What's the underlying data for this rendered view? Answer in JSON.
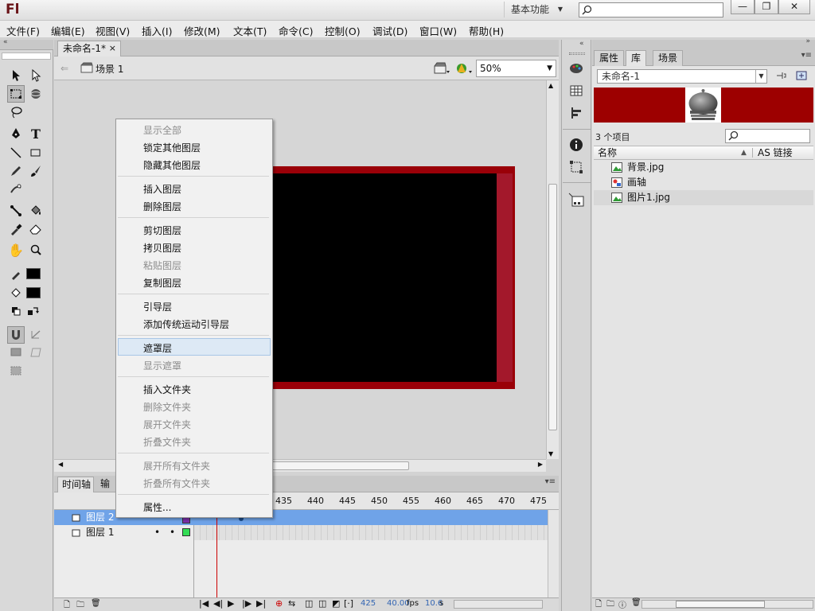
{
  "app": {
    "logo": "Fl",
    "workspace": "基本功能",
    "search_placeholder": ""
  },
  "window_buttons": {
    "minimize": "—",
    "restore": "❐",
    "close": "✕"
  },
  "menubar": [
    "文件(F)",
    "编辑(E)",
    "视图(V)",
    "插入(I)",
    "修改(M)",
    "文本(T)",
    "命令(C)",
    "控制(O)",
    "调试(D)",
    "窗口(W)",
    "帮助(H)"
  ],
  "document": {
    "tab": "未命名-1*",
    "tab_close": "×",
    "scene": "场景 1",
    "zoom": "50%"
  },
  "context_menu": [
    {
      "label": "显示全部",
      "disabled": true
    },
    {
      "label": "锁定其他图层",
      "disabled": false
    },
    {
      "label": "隐藏其他图层",
      "disabled": false
    },
    {
      "label": "插入图层",
      "disabled": false
    },
    {
      "label": "删除图层",
      "disabled": false
    },
    {
      "label": "剪切图层",
      "disabled": false
    },
    {
      "label": "拷贝图层",
      "disabled": false
    },
    {
      "label": "粘贴图层",
      "disabled": true
    },
    {
      "label": "复制图层",
      "disabled": false
    },
    {
      "label": "引导层",
      "disabled": false
    },
    {
      "label": "添加传统运动引导层",
      "disabled": false
    },
    {
      "label": "遮罩层",
      "disabled": false,
      "highlighted": true
    },
    {
      "label": "显示遮罩",
      "disabled": true
    },
    {
      "label": "插入文件夹",
      "disabled": false
    },
    {
      "label": "删除文件夹",
      "disabled": true
    },
    {
      "label": "展开文件夹",
      "disabled": true
    },
    {
      "label": "折叠文件夹",
      "disabled": true
    },
    {
      "label": "展开所有文件夹",
      "disabled": true
    },
    {
      "label": "折叠所有文件夹",
      "disabled": true
    },
    {
      "label": "属性...",
      "disabled": false
    }
  ],
  "timeline": {
    "tabs": [
      "时间轴",
      "输出"
    ],
    "ruler": [
      "435",
      "440",
      "445",
      "450",
      "455",
      "460",
      "465",
      "470",
      "475"
    ],
    "layers": [
      {
        "name": "图层 2",
        "selected": true
      },
      {
        "name": "图层 1",
        "selected": false
      }
    ],
    "status": {
      "frame": "425",
      "fps_value": "40.00",
      "fps_unit": "fps",
      "time_value": "10.6",
      "time_unit": "s"
    }
  },
  "right_panel": {
    "tabs": [
      "属性",
      "库",
      "场景"
    ],
    "active_tab": "库",
    "library_doc": "未命名-1",
    "item_count": "3 个项目",
    "col_name": "名称",
    "col_link": "AS 链接",
    "items": [
      {
        "name": "背景.jpg",
        "type": "bitmap"
      },
      {
        "name": "画轴",
        "type": "graphic"
      },
      {
        "name": "图片1.jpg",
        "type": "bitmap",
        "selected": true
      }
    ]
  },
  "colors": {
    "stage_red": "#9a0008",
    "stage_right_strip": "#a3182b",
    "stage_black": "#000000",
    "preview_bg": "#9d0000",
    "layer_selected": "#6fa3e8",
    "playhead": "#cc0000"
  }
}
